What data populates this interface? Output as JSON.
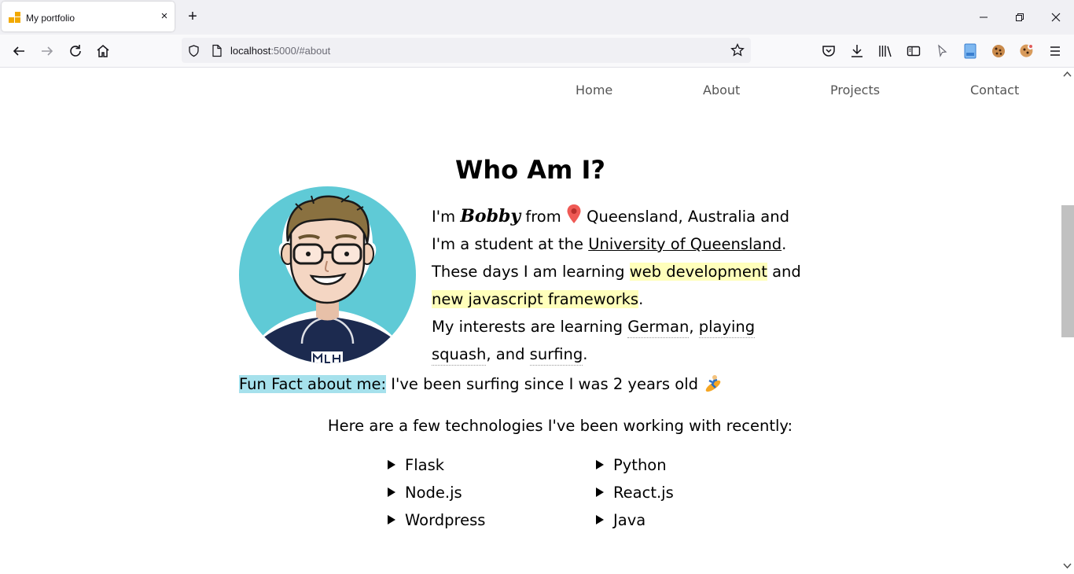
{
  "browser": {
    "tab_title": "My portfolio",
    "tab_close": "×",
    "new_tab": "+",
    "url_host": "localhost",
    "url_rest": ":5000/#about"
  },
  "nav": {
    "home": "Home",
    "about": "About",
    "projects": "Projects",
    "contact": "Contact"
  },
  "about": {
    "heading": "Who Am I?",
    "bio": {
      "im": "I'm ",
      "name": "Bobby",
      "from": " from ",
      "location": " Queensland, Australia and I'm a student at the ",
      "university": "University of Queensland",
      "period": ".",
      "days_prefix": "These days I am learning ",
      "hl1": "web development",
      "and": " and ",
      "hl2": "new javascript frameworks",
      "period2": ".",
      "interests_prefix": "My interests are learning ",
      "interest1": "German",
      "comma": ", ",
      "interest2": "playing squash",
      "and2": ", and ",
      "interest3": "surfing",
      "period3": "."
    },
    "fun_fact_label": "Fun Fact about me:",
    "fun_fact_text": " I've been surfing since I was 2 years old "
  },
  "tech": {
    "intro": "Here are a few technologies I've been working with recently:",
    "left": [
      "Flask",
      "Node.js",
      "Wordpress"
    ],
    "right": [
      "Python",
      "React.js",
      "Java"
    ]
  }
}
